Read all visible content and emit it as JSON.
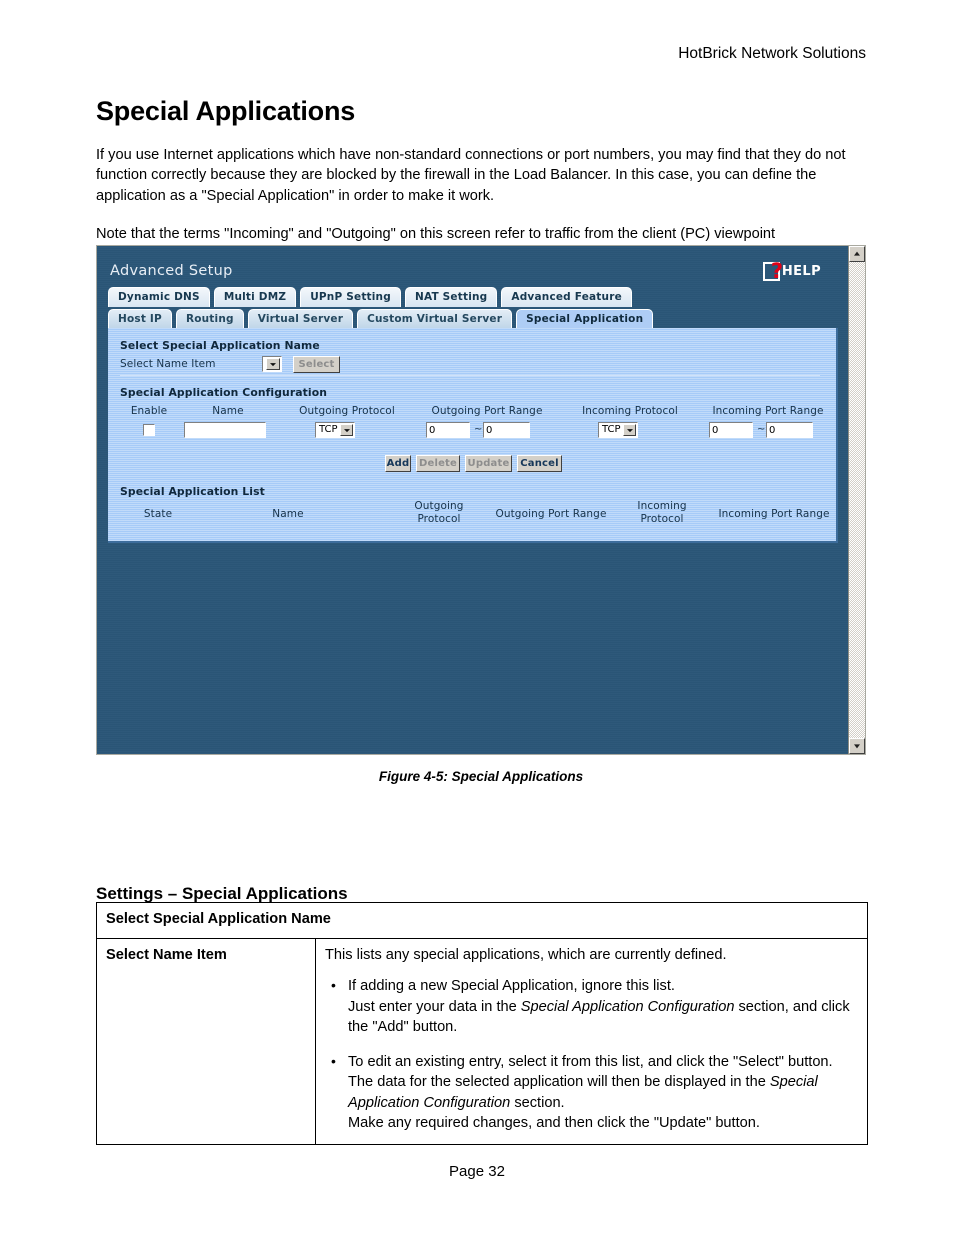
{
  "document": {
    "header_right": "HotBrick Network Solutions",
    "title": "Special Applications",
    "paragraph_1": "If you use Internet applications which have non-standard connections or port numbers, you may find that they do not function correctly because they are blocked by the firewall in the Load Balancer. In this case, you can define the application as a \"Special Application\" in order to make it work.",
    "paragraph_2": "Note that the terms \"Incoming\" and \"Outgoing\" on this screen refer to traffic from the client (PC) viewpoint",
    "figure_caption": "Figure 4-5: Special Applications",
    "settings_heading": "Settings – Special Applications",
    "footer": "Page 32"
  },
  "screenshot": {
    "app_title": "Advanced Setup",
    "help_label": "HELP",
    "help_icon": "help-document-question-icon",
    "colors": {
      "background": "#2b5678",
      "panel": "#a6cbf8",
      "active_tab": "#aecdf5",
      "help_question": "#e00018"
    },
    "tabs_row_1": [
      {
        "label": "Dynamic DNS",
        "active": false
      },
      {
        "label": "Multi DMZ",
        "active": false
      },
      {
        "label": "UPnP Setting",
        "active": false
      },
      {
        "label": "NAT Setting",
        "active": false
      },
      {
        "label": "Advanced Feature",
        "active": false
      }
    ],
    "tabs_row_2": [
      {
        "label": "Host IP",
        "active": false
      },
      {
        "label": "Routing",
        "active": false
      },
      {
        "label": "Virtual Server",
        "active": false
      },
      {
        "label": "Custom Virtual Server",
        "active": false
      },
      {
        "label": "Special Application",
        "active": true
      }
    ],
    "select_section": {
      "heading": "Select Special Application Name",
      "field_label": "Select Name Item",
      "dropdown_value": "",
      "select_button": "Select",
      "select_button_enabled": false
    },
    "config_section": {
      "heading": "Special Application Configuration",
      "columns": [
        "Enable",
        "Name",
        "Outgoing Protocol",
        "Outgoing Port Range",
        "Incoming Protocol",
        "Incoming Port Range"
      ],
      "enable_checked": false,
      "name_value": "",
      "outgoing_protocol": "TCP",
      "outgoing_port_start": "0",
      "outgoing_port_end": "0",
      "incoming_protocol": "TCP",
      "incoming_port_start": "0",
      "incoming_port_end": "0",
      "range_separator": "~"
    },
    "buttons": [
      {
        "label": "Add",
        "enabled": true
      },
      {
        "label": "Delete",
        "enabled": false
      },
      {
        "label": "Update",
        "enabled": false
      },
      {
        "label": "Cancel",
        "enabled": true
      }
    ],
    "list_section": {
      "heading": "Special Application List",
      "columns": [
        "State",
        "Name",
        "Outgoing\nProtocol",
        "Outgoing Port Range",
        "Incoming\nProtocol",
        "Incoming Port Range"
      ],
      "rows": []
    }
  },
  "settings_table": {
    "section_header": "Select Special Application Name",
    "row_key": "Select Name Item",
    "row_intro": "This lists any special applications, which are currently defined.",
    "bullets": [
      {
        "part1": "If adding a new Special Application, ignore this list.",
        "part2a": "Just enter your data in the ",
        "italic": "Special Application Configuration",
        "part2b": " section, and click the \"Add\" button."
      },
      {
        "part1": "To edit an existing entry, select it from this list, and click the \"Select\" button. The data for the selected application will then be displayed in the ",
        "italic": "Special Application Configuration",
        "part2b": " section.",
        "part3": "Make any required changes, and then click the \"Update\" button."
      }
    ]
  }
}
